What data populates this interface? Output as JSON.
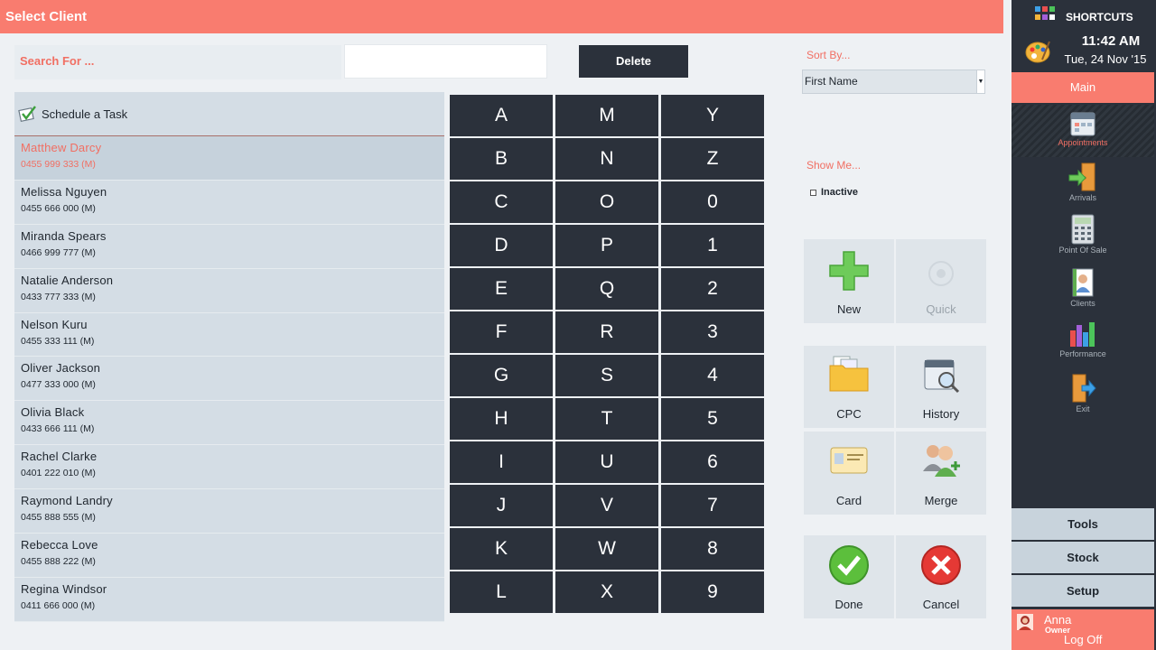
{
  "window": {
    "title": "Select Client"
  },
  "search": {
    "label": "Search For ...",
    "value": "",
    "delete_label": "Delete"
  },
  "task_row": {
    "label": "Schedule a Task"
  },
  "clients": [
    {
      "name": "Matthew  Darcy",
      "phone": "0455 999 333 (M)",
      "selected": true
    },
    {
      "name": "Melissa  Nguyen",
      "phone": "0455 666 000 (M)"
    },
    {
      "name": "Miranda  Spears",
      "phone": "0466 999 777 (M)"
    },
    {
      "name": "Natalie  Anderson",
      "phone": "0433 777 333 (M)"
    },
    {
      "name": "Nelson  Kuru",
      "phone": "0455 333 111 (M)"
    },
    {
      "name": "Oliver  Jackson",
      "phone": "0477 333 000 (M)"
    },
    {
      "name": "Olivia  Black",
      "phone": "0433 666 111 (M)"
    },
    {
      "name": "Rachel  Clarke",
      "phone": "0401 222 010 (M)"
    },
    {
      "name": "Raymond  Landry",
      "phone": "0455 888 555 (M)"
    },
    {
      "name": "Rebecca  Love",
      "phone": "0455 888 222 (M)"
    },
    {
      "name": "Regina  Windsor",
      "phone": "0411 666 000 (M)"
    }
  ],
  "keypad": [
    "A",
    "M",
    "Y",
    "B",
    "N",
    "Z",
    "C",
    "O",
    "0",
    "D",
    "P",
    "1",
    "E",
    "Q",
    "2",
    "F",
    "R",
    "3",
    "G",
    "S",
    "4",
    "H",
    "T",
    "5",
    "I",
    "U",
    "6",
    "J",
    "V",
    "7",
    "K",
    "W",
    "8",
    "L",
    "X",
    "9"
  ],
  "sort": {
    "label": "Sort By...",
    "value": "First Name"
  },
  "show": {
    "label": "Show Me...",
    "inactive_label": "Inactive",
    "inactive_checked": false
  },
  "tiles": {
    "new": "New",
    "quick": "Quick",
    "cpc": "CPC",
    "history": "History",
    "card": "Card",
    "merge": "Merge",
    "done": "Done",
    "cancel": "Cancel"
  },
  "sidebar": {
    "shortcuts": "SHORTCUTS",
    "time": "11:42 AM",
    "date": "Tue, 24 Nov '15",
    "main": "Main",
    "nav": [
      {
        "label": "Appointments",
        "icon": "calendar-icon",
        "active": true
      },
      {
        "label": "Arrivals",
        "icon": "door-arrow-icon"
      },
      {
        "label": "Point Of Sale",
        "icon": "calculator-icon"
      },
      {
        "label": "Clients",
        "icon": "clients-icon"
      },
      {
        "label": "Performance",
        "icon": "bar-chart-icon"
      },
      {
        "label": "Exit",
        "icon": "exit-icon"
      }
    ],
    "tools": "Tools",
    "stock": "Stock",
    "setup": "Setup",
    "user": {
      "name": "Anna",
      "role": "Owner",
      "logoff": "Log Off"
    }
  },
  "colors": {
    "accent": "#f97c6f",
    "dark": "#2b313b",
    "panel": "#d4dde5"
  }
}
